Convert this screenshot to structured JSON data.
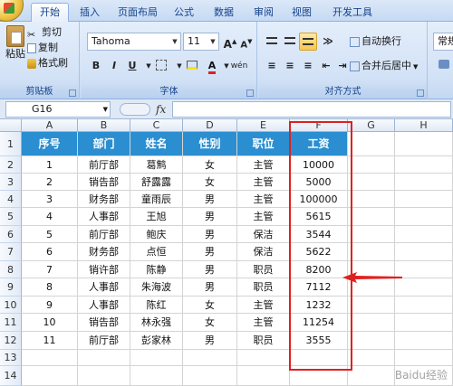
{
  "ribbon_tabs": [
    "开始",
    "插入",
    "页面布局",
    "公式",
    "数据",
    "审阅",
    "视图",
    "开发工具"
  ],
  "clipboard": {
    "paste": "粘贴",
    "cut": "剪切",
    "copy": "复制",
    "format_painter": "格式刷",
    "label": "剪贴板"
  },
  "font": {
    "name": "Tahoma",
    "size": "11",
    "grow": "A",
    "shrink": "A",
    "bold": "B",
    "italic": "I",
    "underline": "U",
    "font_color": "A",
    "phonetic": "wén",
    "label": "字体"
  },
  "alignment": {
    "wrap_text": "自动换行",
    "merge_center": "合并后居中",
    "label": "对齐方式"
  },
  "number": {
    "format": "常规"
  },
  "formula_bar": {
    "name_box": "G16",
    "fx": "fx",
    "formula": ""
  },
  "columns": [
    "A",
    "B",
    "C",
    "D",
    "E",
    "F",
    "G",
    "H"
  ],
  "rows": [
    "1",
    "2",
    "3",
    "4",
    "5",
    "6",
    "7",
    "8",
    "9",
    "10",
    "11",
    "12",
    "13",
    "14"
  ],
  "table": {
    "headers": [
      "序号",
      "部门",
      "姓名",
      "性别",
      "职位",
      "工资"
    ],
    "rows": [
      [
        "1",
        "前厅部",
        "葛鹪",
        "女",
        "主管",
        "10000"
      ],
      [
        "2",
        "销告部",
        "舒露露",
        "女",
        "主管",
        "5000"
      ],
      [
        "3",
        "财务部",
        "童雨辰",
        "男",
        "主管",
        "100000"
      ],
      [
        "4",
        "人事部",
        "王旭",
        "男",
        "主管",
        "5615"
      ],
      [
        "5",
        "前厅部",
        "鲍庆",
        "男",
        "保洁",
        "3544"
      ],
      [
        "6",
        "财务部",
        "点恒",
        "男",
        "保洁",
        "5622"
      ],
      [
        "7",
        "销许部",
        "陈静",
        "男",
        "职员",
        "8200"
      ],
      [
        "8",
        "人事部",
        "朱海波",
        "男",
        "职员",
        "7112"
      ],
      [
        "9",
        "人事部",
        "陈红",
        "女",
        "主管",
        "1232"
      ],
      [
        "10",
        "销告部",
        "林永强",
        "女",
        "主管",
        "11254"
      ],
      [
        "11",
        "前厅部",
        "彭家林",
        "男",
        "职员",
        "3555"
      ]
    ]
  },
  "colors": {
    "header_fill": "#2a8ed0",
    "annotation": "#e02020"
  },
  "watermark": "Baidu经验"
}
